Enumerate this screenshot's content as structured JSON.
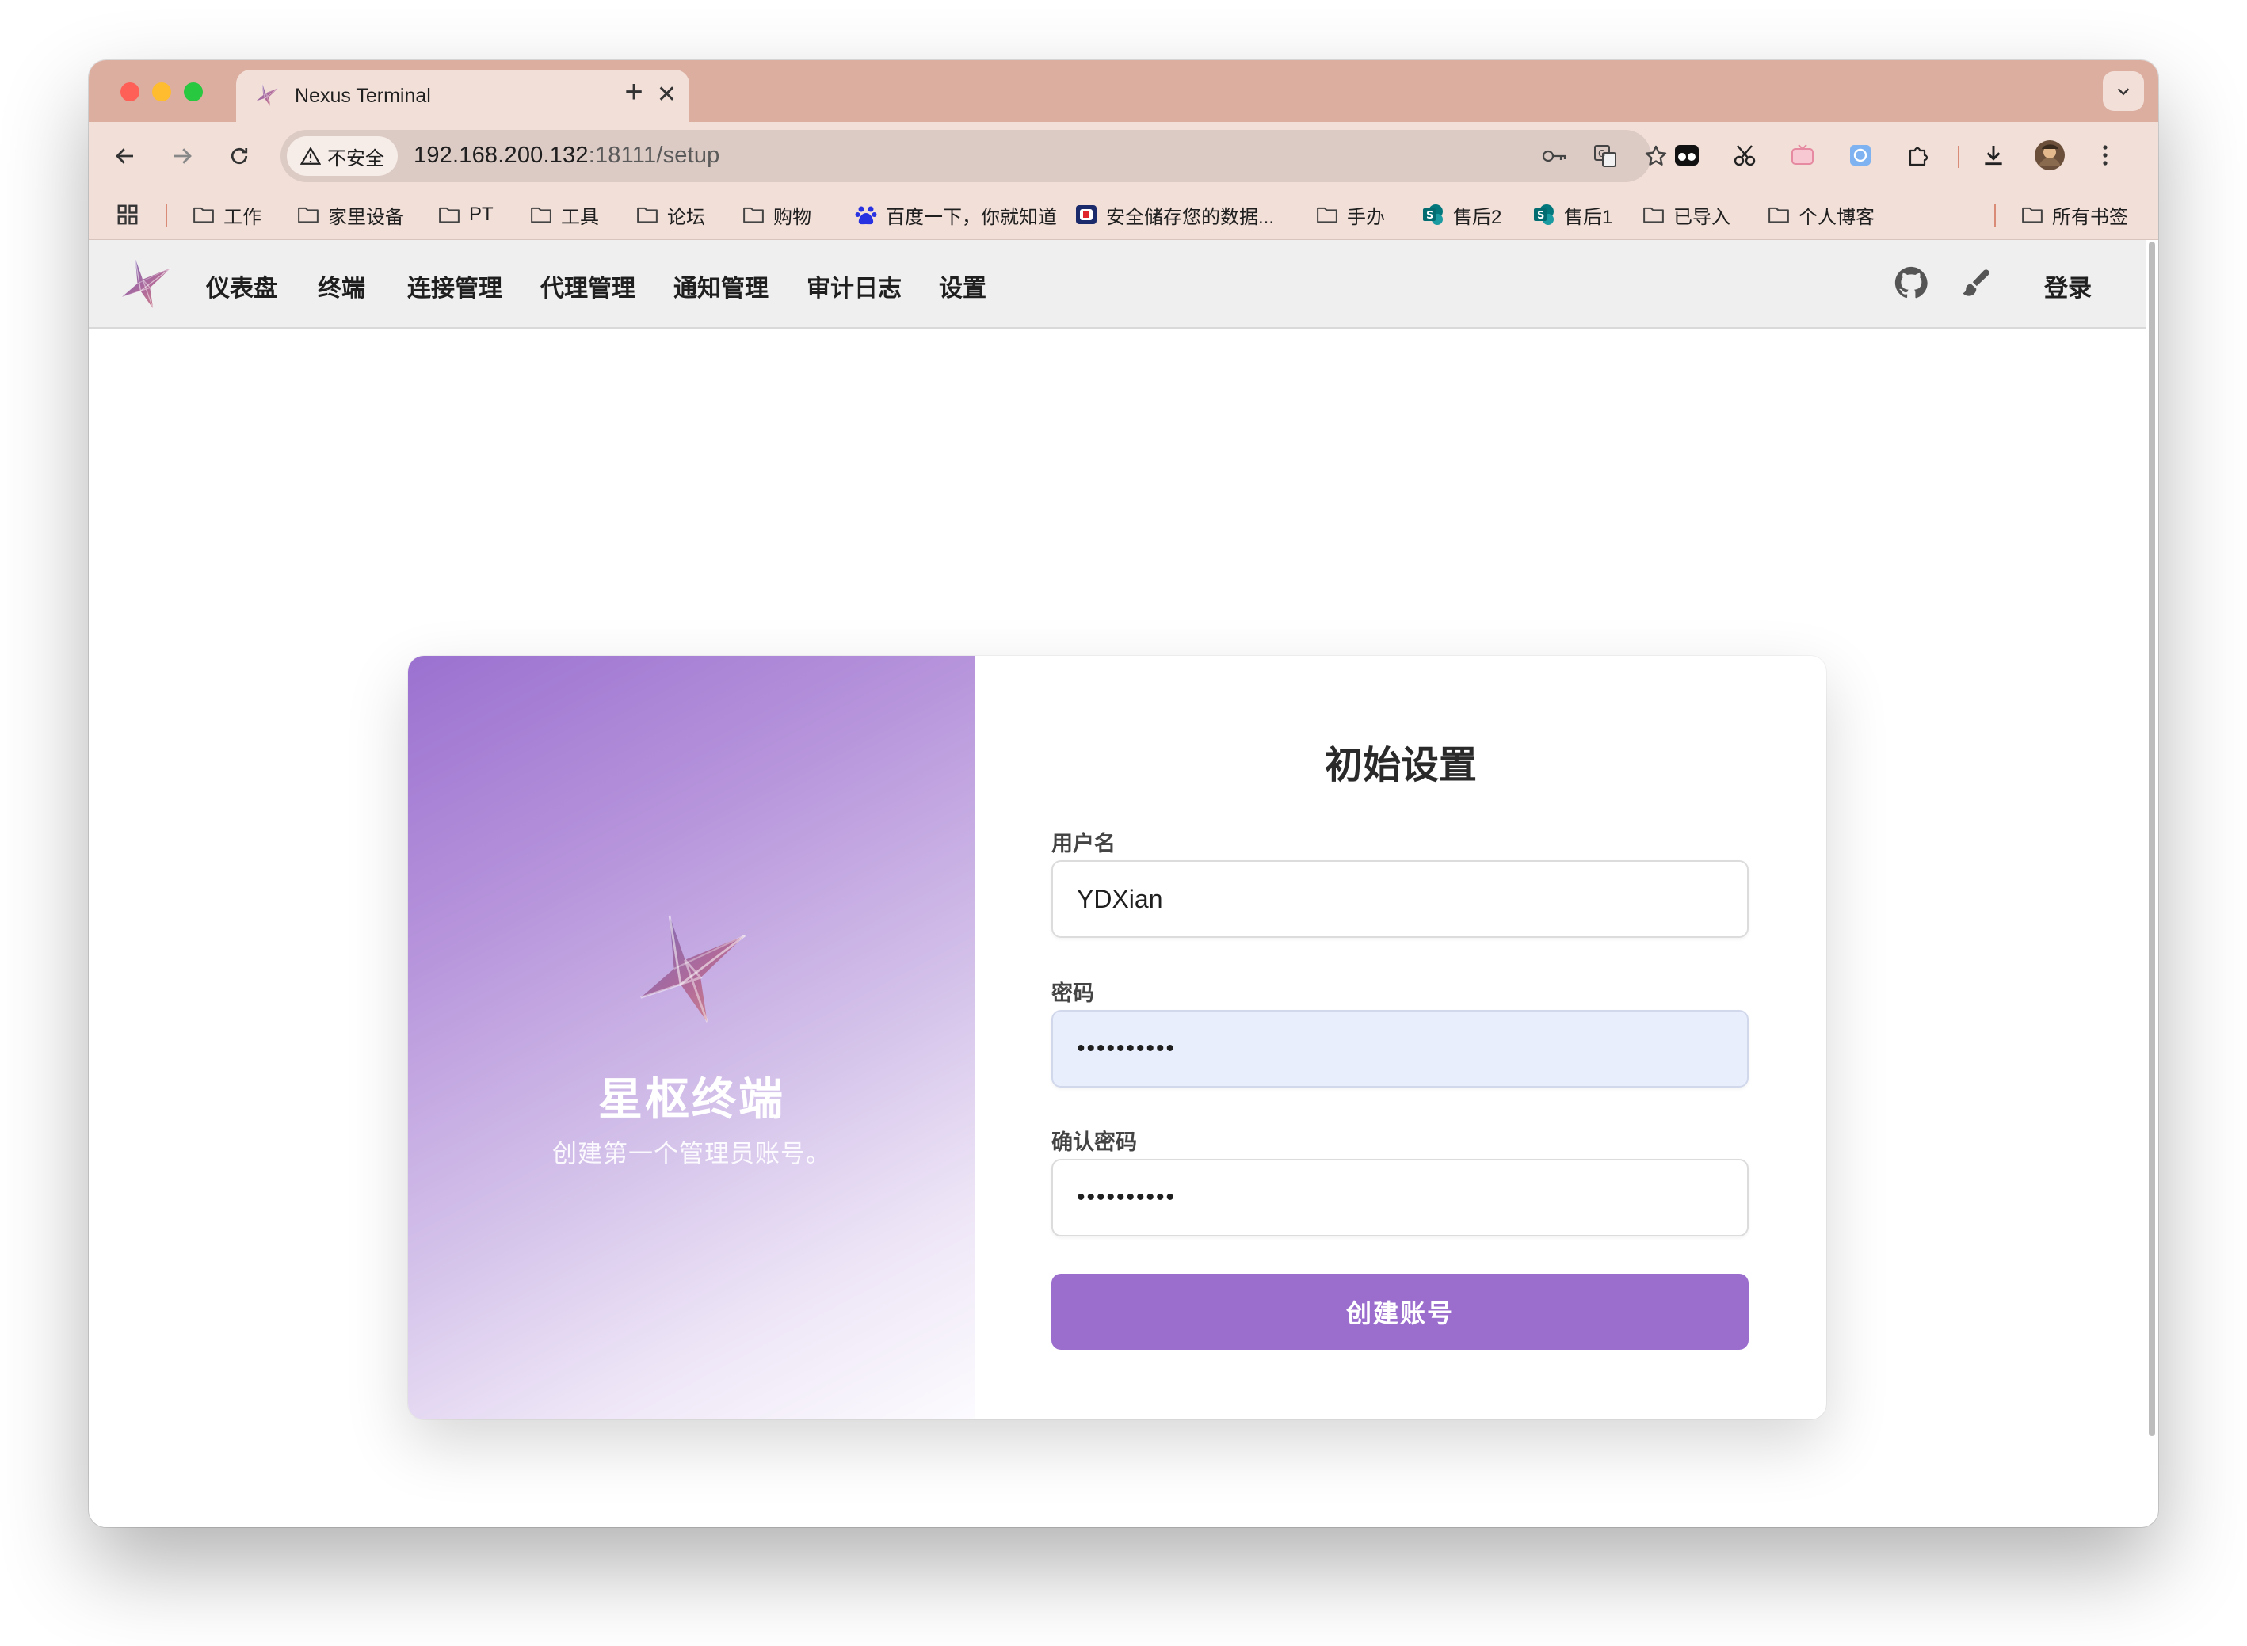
{
  "browser": {
    "tab_title": "Nexus Terminal",
    "security_label": "不安全",
    "url_host": "192.168.200.132",
    "url_path": ":18111/setup",
    "bookmarks": [
      {
        "label": "工作",
        "icon": "folder-icon"
      },
      {
        "label": "家里设备",
        "icon": "folder-icon"
      },
      {
        "label": "PT",
        "icon": "folder-icon"
      },
      {
        "label": "工具",
        "icon": "folder-icon"
      },
      {
        "label": "论坛",
        "icon": "folder-icon"
      },
      {
        "label": "购物",
        "icon": "folder-icon"
      },
      {
        "label": "百度一下，你就知道",
        "icon": "baidu-icon"
      },
      {
        "label": "安全储存您的数据...",
        "icon": "q-icon"
      },
      {
        "label": "手办",
        "icon": "folder-icon"
      },
      {
        "label": "售后2",
        "icon": "sharepoint-icon"
      },
      {
        "label": "售后1",
        "icon": "sharepoint-icon"
      },
      {
        "label": "已导入",
        "icon": "folder-icon"
      },
      {
        "label": "个人博客",
        "icon": "folder-icon"
      }
    ],
    "all_bookmarks": "所有书签"
  },
  "app_nav": {
    "items": [
      "仪表盘",
      "终端",
      "连接管理",
      "代理管理",
      "通知管理",
      "审计日志",
      "设置"
    ],
    "login": "登录"
  },
  "hero": {
    "title": "星枢终端",
    "subtitle": "创建第一个管理员账号。"
  },
  "form": {
    "title": "初始设置",
    "username_label": "用户名",
    "username_value": "YDXian",
    "password_label": "密码",
    "password_value": "••••••••••",
    "confirm_label": "确认密码",
    "confirm_value": "••••••••••",
    "submit_label": "创建账号"
  },
  "colors": {
    "accent": "#9b6ece",
    "tab_strip": "#dcaea0",
    "toolbar": "#f2dfd8",
    "autofill_bg": "#e9eefc"
  }
}
